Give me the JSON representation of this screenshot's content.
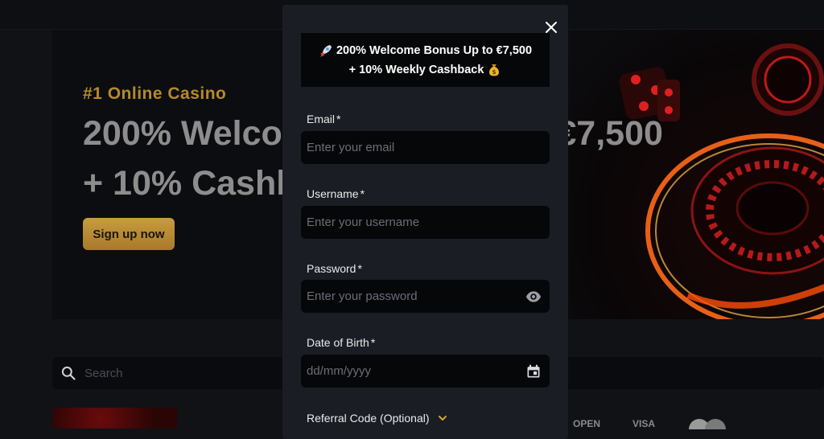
{
  "hero": {
    "eyebrow": "#1 Online Casino",
    "title_line1": "200% Welcome Bonus Up to €7,500",
    "title_line2": "+ 10% Cashback",
    "cta_label": "Sign up now"
  },
  "search": {
    "placeholder": "Search"
  },
  "payments": [
    "OPEN",
    "VISA",
    "",
    ""
  ],
  "modal": {
    "promo_line1": "200% Welcome Bonus Up to €7,500",
    "promo_line2": "+ 10% Weekly Cashback",
    "promo_icon1": "rocket-emoji",
    "promo_icon2": "money-bag-emoji",
    "fields": [
      {
        "label": "Email",
        "required": "*",
        "placeholder": "Enter your email"
      },
      {
        "label": "Username",
        "required": "*",
        "placeholder": "Enter your username"
      },
      {
        "label": "Password",
        "required": "*",
        "placeholder": "Enter your password"
      },
      {
        "label": "Date of Birth",
        "required": "*",
        "placeholder": "dd/mm/yyyy"
      }
    ],
    "referral_label": "Referral Code (Optional)"
  },
  "colors": {
    "accent_gold": "#c79c3e",
    "modal_bg": "#1a1d23",
    "input_bg": "#060709",
    "page_bg": "#101216"
  }
}
